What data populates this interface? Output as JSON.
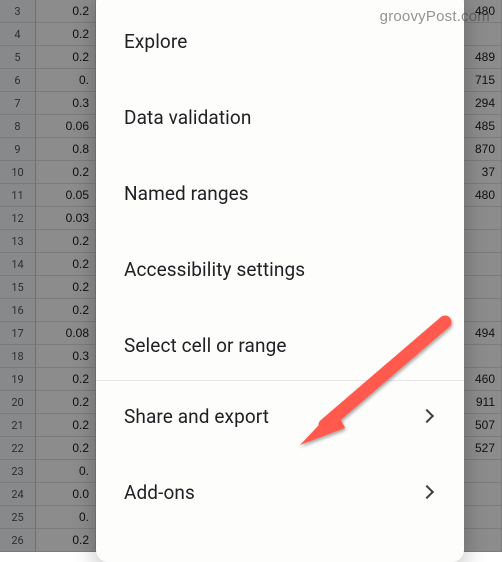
{
  "watermark": "groovyPost.com",
  "menu": {
    "items": [
      {
        "label": "Explore",
        "chevron": false
      },
      {
        "label": "Data validation",
        "chevron": false
      },
      {
        "label": "Named ranges",
        "chevron": false
      },
      {
        "label": "Accessibility settings",
        "chevron": false
      },
      {
        "label": "Select cell or range",
        "chevron": false
      },
      {
        "label": "Share and export",
        "chevron": true
      },
      {
        "label": "Add-ons",
        "chevron": true
      }
    ]
  },
  "spreadsheet": {
    "row_start": 3,
    "row_count": 24,
    "left_values": [
      "0.2",
      "0.2",
      "0.2",
      "0.",
      "0.3",
      "0.06",
      "0.8",
      "0.2",
      "0.05",
      "0.03",
      "0.2",
      "0.2",
      "0.2",
      "0.2",
      "0.08",
      "0.3",
      "0.2",
      "0.2",
      "0.2",
      "0.2",
      "0.",
      "0.0",
      "0.",
      "0.2"
    ],
    "right_values": [
      "480",
      "",
      "489",
      "715",
      "294",
      "485",
      "870",
      "37",
      "480",
      "",
      "",
      "",
      "",
      "",
      "494",
      "",
      "460",
      "911",
      "507",
      "527",
      "",
      "",
      "",
      ""
    ]
  },
  "annotation_color": "#ff5a4d"
}
